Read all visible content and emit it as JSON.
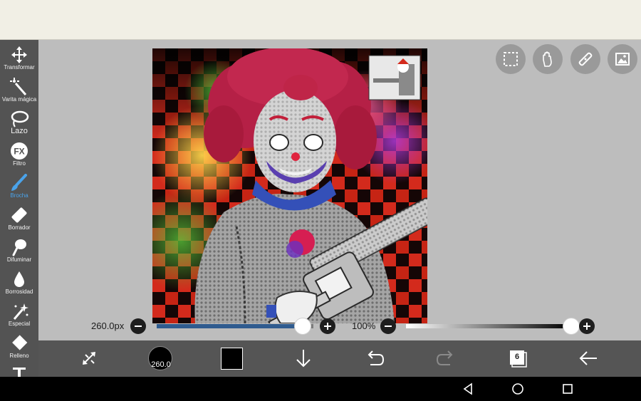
{
  "toolbar": {
    "tools": [
      {
        "label": "Transformar",
        "icon": "move-arrows-icon"
      },
      {
        "label": "Varita mágica",
        "icon": "magic-wand-icon"
      },
      {
        "label": "Lazo",
        "icon": "lasso-icon"
      },
      {
        "label": "Filtro",
        "icon": "fx-icon"
      },
      {
        "label": "Brocha",
        "icon": "brush-icon",
        "active": true
      },
      {
        "label": "Borrador",
        "icon": "eraser-icon"
      },
      {
        "label": "Difuminar",
        "icon": "smudge-icon"
      },
      {
        "label": "Borrosidad",
        "icon": "blur-drop-icon"
      },
      {
        "label": "Especial",
        "icon": "special-sparkle-icon"
      },
      {
        "label": "Relleno",
        "icon": "fill-bucket-icon"
      },
      {
        "label": "",
        "icon": "text-icon"
      }
    ],
    "active_color": "#4aa3ea"
  },
  "canvas_actions": [
    "selection-icon",
    "hand-icon",
    "ruler-icon",
    "image-icon"
  ],
  "brush_size": {
    "value_label": "260.0px",
    "fraction": 0.93
  },
  "opacity": {
    "value_label": "100%",
    "fraction": 1.0
  },
  "bottom_bar": {
    "brush_preview_label": "260.0",
    "current_color": "#000000",
    "layers_count": "6"
  },
  "colors": {
    "top_bar": "#f1efe5",
    "toolbar": "#535353",
    "workspace": "#bdbdbd",
    "accent": "#4aa3ea"
  }
}
